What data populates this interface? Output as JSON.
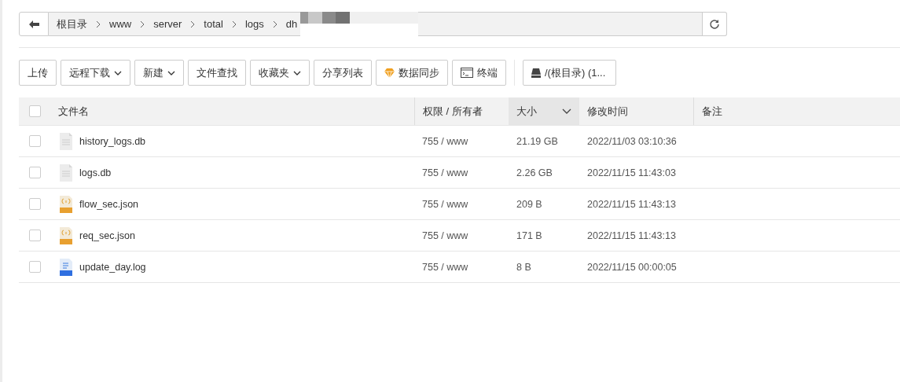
{
  "path_bar": {
    "crumbs": [
      "根目录",
      "www",
      "server",
      "total",
      "logs",
      "dh"
    ]
  },
  "toolbar": {
    "buttons": [
      {
        "label": "上传",
        "dropdown": false
      },
      {
        "label": "远程下载",
        "dropdown": true
      },
      {
        "label": "新建",
        "dropdown": true
      },
      {
        "label": "文件查找",
        "dropdown": false
      },
      {
        "label": "收藏夹",
        "dropdown": true
      },
      {
        "label": "分享列表",
        "dropdown": false
      },
      {
        "label": "数据同步",
        "dropdown": false,
        "kind": "diamond"
      },
      {
        "label": "终端",
        "dropdown": false,
        "kind": "terminal"
      }
    ],
    "disk": {
      "label": "/(根目录) (1..."
    }
  },
  "table": {
    "select_all": {
      "checked": false
    },
    "columns": [
      {
        "label": "文件名",
        "sorted": false
      },
      {
        "label": "权限 / 所有者",
        "sorted": false
      },
      {
        "label": "大小",
        "sorted": true
      },
      {
        "label": "修改时间",
        "sorted": false
      },
      {
        "label": "备注",
        "sorted": false
      }
    ],
    "rows": [
      {
        "checked": false,
        "kind": "doc",
        "name": "history_logs.db",
        "perm": "755 / www",
        "size": "21.19 GB",
        "mtime": "2022/11/03 03:10:36"
      },
      {
        "checked": false,
        "kind": "doc",
        "name": "logs.db",
        "perm": "755 / www",
        "size": "2.26 GB",
        "mtime": "2022/11/15 11:43:03"
      },
      {
        "checked": false,
        "kind": "json",
        "name": "flow_sec.json",
        "perm": "755 / www",
        "size": "209 B",
        "mtime": "2022/11/15 11:43:13"
      },
      {
        "checked": false,
        "kind": "json",
        "name": "req_sec.json",
        "perm": "755 / www",
        "size": "171 B",
        "mtime": "2022/11/15 11:43:13"
      },
      {
        "checked": false,
        "kind": "log",
        "name": "update_day.log",
        "perm": "755 / www",
        "size": "8 B",
        "mtime": "2022/11/15 00:00:05"
      }
    ]
  }
}
